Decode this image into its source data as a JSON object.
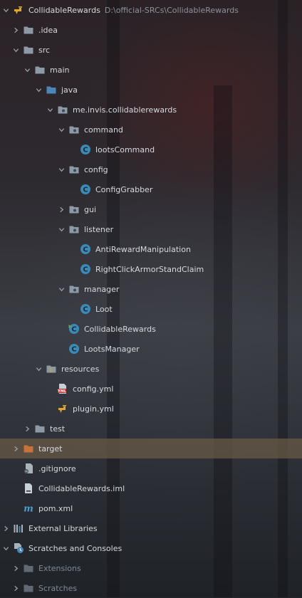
{
  "project_tree": {
    "root": {
      "label": "CollidableRewards",
      "path": "D:\\official-SRCs\\CollidableRewards"
    },
    "items": [
      {
        "label": ".idea"
      },
      {
        "label": "src"
      },
      {
        "label": "main"
      },
      {
        "label": "java"
      },
      {
        "label": "me.invis.collidablerewards"
      },
      {
        "label": "command"
      },
      {
        "label": "lootsCommand"
      },
      {
        "label": "config"
      },
      {
        "label": "ConfigGrabber"
      },
      {
        "label": "gui"
      },
      {
        "label": "listener"
      },
      {
        "label": "AntiRewardManipulation"
      },
      {
        "label": "RightClickArmorStandClaim"
      },
      {
        "label": "manager"
      },
      {
        "label": "Loot"
      },
      {
        "label": "CollidableRewards"
      },
      {
        "label": "LootsManager"
      },
      {
        "label": "resources"
      },
      {
        "label": "config.yml"
      },
      {
        "label": "plugin.yml"
      },
      {
        "label": "test"
      },
      {
        "label": "target"
      },
      {
        "label": ".gitignore"
      },
      {
        "label": "CollidableRewards.iml"
      },
      {
        "label": "pom.xml"
      },
      {
        "label": "External Libraries"
      },
      {
        "label": "Scratches and Consoles"
      },
      {
        "label": "Extensions"
      },
      {
        "label": "Scratches"
      }
    ],
    "selected_item": "target",
    "colors": {
      "folder": "#8d9aa6",
      "source_folder": "#4a86b8",
      "excluded_folder": "#c5733a",
      "class_icon": "#3b8bb8",
      "selection": "#695c46"
    }
  }
}
